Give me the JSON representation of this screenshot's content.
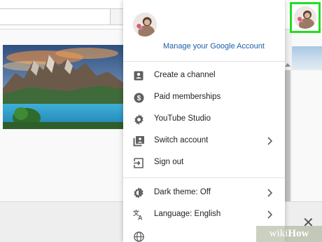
{
  "header": {
    "search_placeholder": ""
  },
  "account_menu": {
    "manage_account_link": "Manage your Google Account",
    "items": [
      {
        "label": "Create a channel",
        "icon": "person-badge-icon",
        "has_submenu": false
      },
      {
        "label": "Paid memberships",
        "icon": "dollar-circle-icon",
        "has_submenu": false
      },
      {
        "label": "YouTube Studio",
        "icon": "gear-icon",
        "has_submenu": false
      },
      {
        "label": "Switch account",
        "icon": "switch-account-icon",
        "has_submenu": true
      },
      {
        "label": "Sign out",
        "icon": "sign-out-icon",
        "has_submenu": false
      },
      {
        "label": "Dark theme: Off",
        "icon": "dark-theme-icon",
        "has_submenu": true
      },
      {
        "label": "Language: English",
        "icon": "translate-icon",
        "has_submenu": true
      },
      {
        "label": "",
        "icon": "globe-icon",
        "has_submenu": false
      }
    ]
  },
  "watermark": {
    "wiki": "wiki",
    "how": "How"
  },
  "colors": {
    "highlight": "#22dd22",
    "link": "#1a5fa8",
    "icon": "#606060"
  }
}
